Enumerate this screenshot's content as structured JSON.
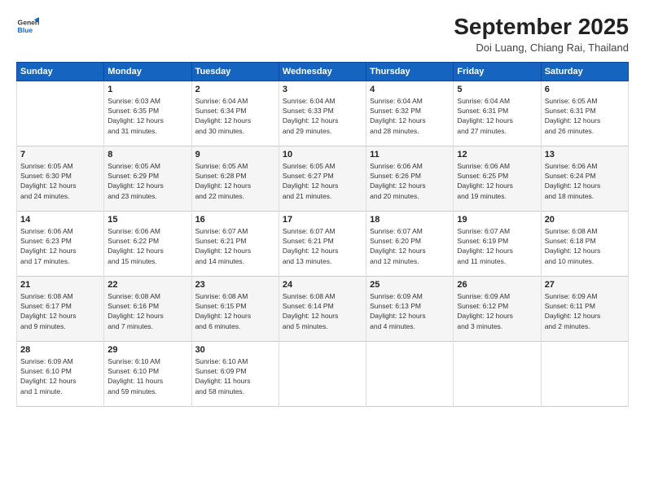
{
  "logo": {
    "line1": "General",
    "line2": "Blue"
  },
  "title": "September 2025",
  "location": "Doi Luang, Chiang Rai, Thailand",
  "days_header": [
    "Sunday",
    "Monday",
    "Tuesday",
    "Wednesday",
    "Thursday",
    "Friday",
    "Saturday"
  ],
  "weeks": [
    [
      {
        "date": "",
        "info": ""
      },
      {
        "date": "1",
        "info": "Sunrise: 6:03 AM\nSunset: 6:35 PM\nDaylight: 12 hours\nand 31 minutes."
      },
      {
        "date": "2",
        "info": "Sunrise: 6:04 AM\nSunset: 6:34 PM\nDaylight: 12 hours\nand 30 minutes."
      },
      {
        "date": "3",
        "info": "Sunrise: 6:04 AM\nSunset: 6:33 PM\nDaylight: 12 hours\nand 29 minutes."
      },
      {
        "date": "4",
        "info": "Sunrise: 6:04 AM\nSunset: 6:32 PM\nDaylight: 12 hours\nand 28 minutes."
      },
      {
        "date": "5",
        "info": "Sunrise: 6:04 AM\nSunset: 6:31 PM\nDaylight: 12 hours\nand 27 minutes."
      },
      {
        "date": "6",
        "info": "Sunrise: 6:05 AM\nSunset: 6:31 PM\nDaylight: 12 hours\nand 26 minutes."
      }
    ],
    [
      {
        "date": "7",
        "info": "Sunrise: 6:05 AM\nSunset: 6:30 PM\nDaylight: 12 hours\nand 24 minutes."
      },
      {
        "date": "8",
        "info": "Sunrise: 6:05 AM\nSunset: 6:29 PM\nDaylight: 12 hours\nand 23 minutes."
      },
      {
        "date": "9",
        "info": "Sunrise: 6:05 AM\nSunset: 6:28 PM\nDaylight: 12 hours\nand 22 minutes."
      },
      {
        "date": "10",
        "info": "Sunrise: 6:05 AM\nSunset: 6:27 PM\nDaylight: 12 hours\nand 21 minutes."
      },
      {
        "date": "11",
        "info": "Sunrise: 6:06 AM\nSunset: 6:26 PM\nDaylight: 12 hours\nand 20 minutes."
      },
      {
        "date": "12",
        "info": "Sunrise: 6:06 AM\nSunset: 6:25 PM\nDaylight: 12 hours\nand 19 minutes."
      },
      {
        "date": "13",
        "info": "Sunrise: 6:06 AM\nSunset: 6:24 PM\nDaylight: 12 hours\nand 18 minutes."
      }
    ],
    [
      {
        "date": "14",
        "info": "Sunrise: 6:06 AM\nSunset: 6:23 PM\nDaylight: 12 hours\nand 17 minutes."
      },
      {
        "date": "15",
        "info": "Sunrise: 6:06 AM\nSunset: 6:22 PM\nDaylight: 12 hours\nand 15 minutes."
      },
      {
        "date": "16",
        "info": "Sunrise: 6:07 AM\nSunset: 6:21 PM\nDaylight: 12 hours\nand 14 minutes."
      },
      {
        "date": "17",
        "info": "Sunrise: 6:07 AM\nSunset: 6:21 PM\nDaylight: 12 hours\nand 13 minutes."
      },
      {
        "date": "18",
        "info": "Sunrise: 6:07 AM\nSunset: 6:20 PM\nDaylight: 12 hours\nand 12 minutes."
      },
      {
        "date": "19",
        "info": "Sunrise: 6:07 AM\nSunset: 6:19 PM\nDaylight: 12 hours\nand 11 minutes."
      },
      {
        "date": "20",
        "info": "Sunrise: 6:08 AM\nSunset: 6:18 PM\nDaylight: 12 hours\nand 10 minutes."
      }
    ],
    [
      {
        "date": "21",
        "info": "Sunrise: 6:08 AM\nSunset: 6:17 PM\nDaylight: 12 hours\nand 9 minutes."
      },
      {
        "date": "22",
        "info": "Sunrise: 6:08 AM\nSunset: 6:16 PM\nDaylight: 12 hours\nand 7 minutes."
      },
      {
        "date": "23",
        "info": "Sunrise: 6:08 AM\nSunset: 6:15 PM\nDaylight: 12 hours\nand 6 minutes."
      },
      {
        "date": "24",
        "info": "Sunrise: 6:08 AM\nSunset: 6:14 PM\nDaylight: 12 hours\nand 5 minutes."
      },
      {
        "date": "25",
        "info": "Sunrise: 6:09 AM\nSunset: 6:13 PM\nDaylight: 12 hours\nand 4 minutes."
      },
      {
        "date": "26",
        "info": "Sunrise: 6:09 AM\nSunset: 6:12 PM\nDaylight: 12 hours\nand 3 minutes."
      },
      {
        "date": "27",
        "info": "Sunrise: 6:09 AM\nSunset: 6:11 PM\nDaylight: 12 hours\nand 2 minutes."
      }
    ],
    [
      {
        "date": "28",
        "info": "Sunrise: 6:09 AM\nSunset: 6:10 PM\nDaylight: 12 hours\nand 1 minute."
      },
      {
        "date": "29",
        "info": "Sunrise: 6:10 AM\nSunset: 6:10 PM\nDaylight: 11 hours\nand 59 minutes."
      },
      {
        "date": "30",
        "info": "Sunrise: 6:10 AM\nSunset: 6:09 PM\nDaylight: 11 hours\nand 58 minutes."
      },
      {
        "date": "",
        "info": ""
      },
      {
        "date": "",
        "info": ""
      },
      {
        "date": "",
        "info": ""
      },
      {
        "date": "",
        "info": ""
      }
    ]
  ]
}
